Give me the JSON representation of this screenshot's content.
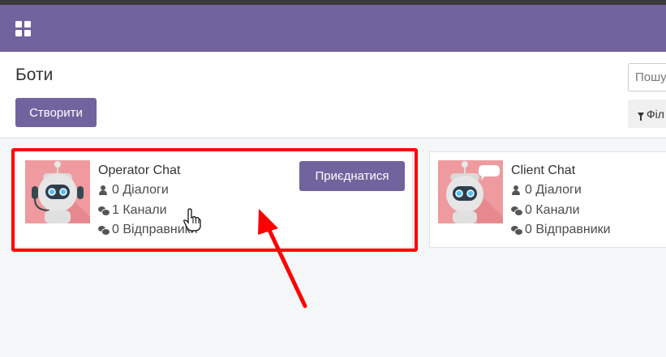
{
  "navbar": {
    "apps_icon": "grid-icon",
    "color": "#71639e"
  },
  "page": {
    "title": "Боти"
  },
  "toolbar": {
    "create_label": "Створити"
  },
  "search": {
    "placeholder": "Пошу"
  },
  "filters": {
    "label": "Філ",
    "icon": "filter-icon"
  },
  "cards": [
    {
      "name": "Operator Chat",
      "dialogs": "0 Діалоги",
      "channels": "1 Канали",
      "senders": "0 Відправники",
      "join_label": "Приєднатися",
      "highlighted": true
    },
    {
      "name": "Client Chat",
      "dialogs": "0 Діалоги",
      "channels": "0 Канали",
      "senders": "0 Відправники"
    }
  ],
  "colors": {
    "accent": "#71639e",
    "annotation": "#ff0000",
    "avatar_bg": "#ef9a9e"
  }
}
